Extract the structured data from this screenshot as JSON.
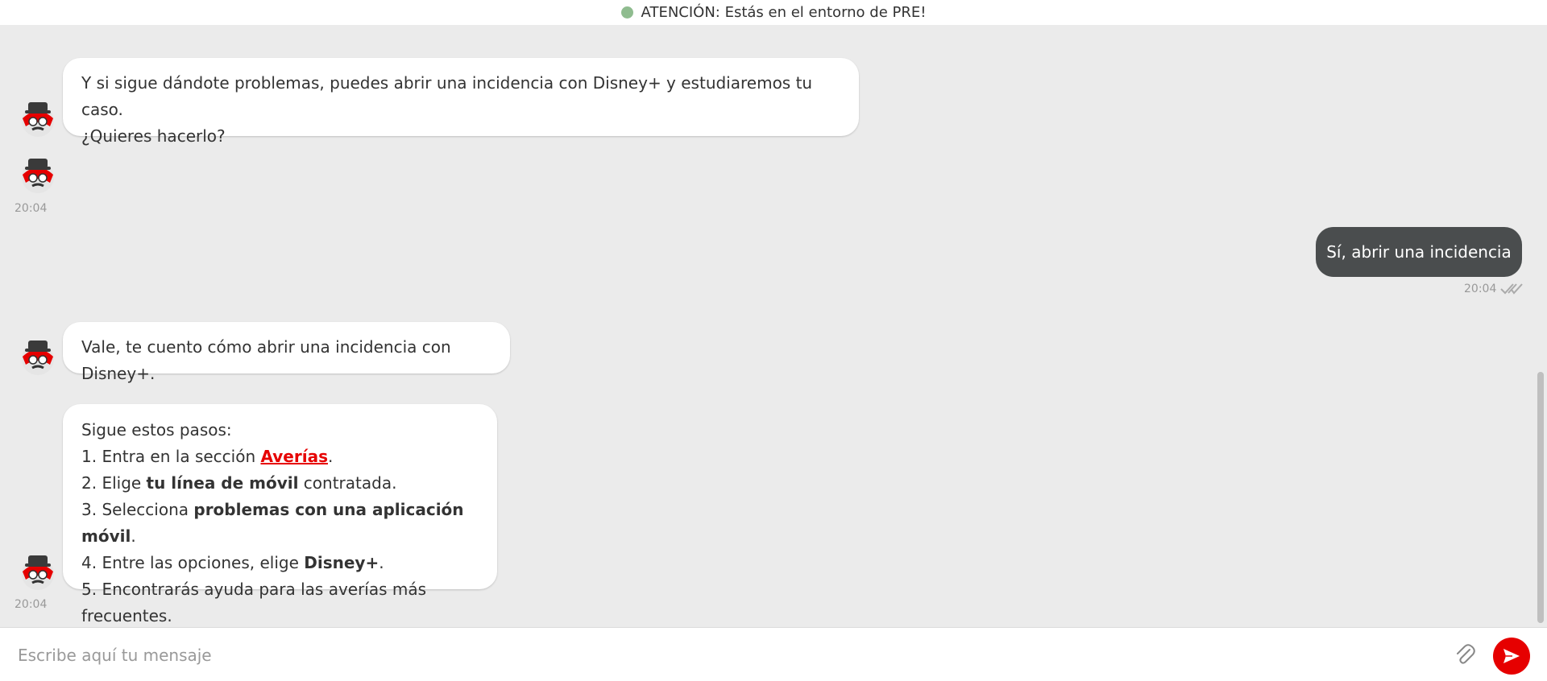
{
  "banner": {
    "text": "ATENCIÓN: Estás en el entorno de PRE!",
    "status_color": "#8fbc8f"
  },
  "messages": {
    "m1": {
      "line1": "Y si sigue dándote problemas, puedes abrir una incidencia con Disney+ y estudiaremos tu caso.",
      "line2": "¿Quieres hacerlo?"
    },
    "time_bot_1": "20:04",
    "user_reply": {
      "text": "Sí, abrir una incidencia",
      "time": "20:04",
      "read_icon": "double-check-icon"
    },
    "m2": {
      "text": "Vale, te cuento cómo abrir una incidencia con Disney+."
    },
    "m3": {
      "intro": "Sigue estos pasos:",
      "step1_pre": "1. Entra en la sección ",
      "step1_link": "Averías",
      "step1_post": ".",
      "step2_pre": "2. Elige ",
      "step2_bold": "tu línea de móvil",
      "step2_post": " contratada.",
      "step3_pre": "3. Selecciona ",
      "step3_bold": "problemas con una aplicación móvil",
      "step3_post": ".",
      "step4_pre": "4. Entre las opciones, elige ",
      "step4_bold": "Disney+",
      "step4_post": ".",
      "step5": "5. Encontrarás ayuda para las averías más frecuentes."
    },
    "time_bot_2": "20:04"
  },
  "composer": {
    "placeholder": "Escribe aquí tu mensaje",
    "attach_icon": "paperclip-icon",
    "send_icon": "send-icon"
  },
  "colors": {
    "accent": "#e60000",
    "user_bubble": "#4a4d4e",
    "background": "#ebebeb"
  }
}
